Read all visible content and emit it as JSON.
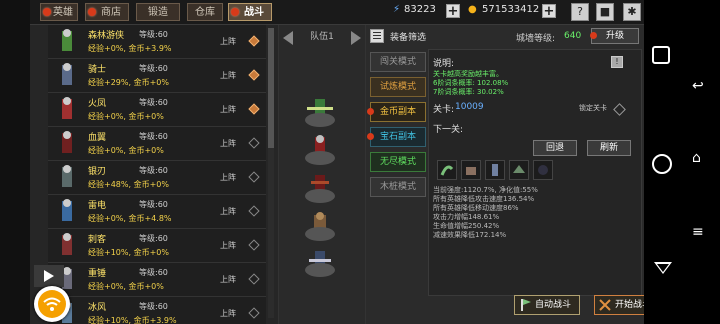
{
  "tabs": [
    {
      "label": "英雄",
      "dot": true,
      "active": false
    },
    {
      "label": "商店",
      "dot": true,
      "active": false
    },
    {
      "label": "锻造",
      "dot": false,
      "active": false
    },
    {
      "label": "仓库",
      "dot": false,
      "active": false
    },
    {
      "label": "战斗",
      "dot": true,
      "active": true
    }
  ],
  "resources": {
    "energy": "83223",
    "gold": "571533412"
  },
  "heroes": [
    {
      "name": "森林游侠",
      "level": "等级:60",
      "bonus": "经验+0%, 金币+3.9%",
      "deploy": "上阵",
      "active": true
    },
    {
      "name": "骑士",
      "level": "等级:60",
      "bonus": "经验+29%, 金币+0%",
      "deploy": "上阵",
      "active": true
    },
    {
      "name": "火凤",
      "level": "等级:60",
      "bonus": "经验+0%, 金币+0%",
      "deploy": "上阵",
      "active": true
    },
    {
      "name": "血翼",
      "level": "等级:60",
      "bonus": "经验+0%, 金币+0%",
      "deploy": "上阵",
      "active": false
    },
    {
      "name": "银刃",
      "level": "等级:60",
      "bonus": "经验+48%, 金币+0%",
      "deploy": "上阵",
      "active": false
    },
    {
      "name": "雷电",
      "level": "等级:60",
      "bonus": "经验+0%, 金币+4.8%",
      "deploy": "上阵",
      "active": false
    },
    {
      "name": "刺客",
      "level": "等级:60",
      "bonus": "经验+10%, 金币+0%",
      "deploy": "上阵",
      "active": false
    },
    {
      "name": "重锤",
      "level": "等级:60",
      "bonus": "经验+0%, 金币+0%",
      "deploy": "上阵",
      "active": false
    },
    {
      "name": "冰风",
      "level": "等级:60",
      "bonus": "经验+10%, 金币+3.9%",
      "deploy": "上阵",
      "active": false
    }
  ],
  "team": {
    "label": "队伍1"
  },
  "panel": {
    "title": "装备筛选",
    "city_label": "城墙等级:",
    "city_level": "640",
    "upgrade": "升级",
    "modes": [
      "闯关模式",
      "试炼模式",
      "金币副本",
      "宝石副本",
      "无尽模式",
      "木桩模式"
    ],
    "desc_label": "说明:",
    "desc_lines": [
      "关卡越高奖励越丰富。",
      "6阶词条概率: 102.08%",
      "7阶词条概率: 30.02%"
    ],
    "stage_label": "关卡:",
    "stage_value": "10009",
    "lock_label": "锁定关卡",
    "next_label": "下一关:",
    "back_btn": "回退",
    "refresh_btn": "刷新",
    "stats": [
      "当前强度:1120.7%, 净化值:55%",
      "所有英雄降低攻击速度136.54%",
      "所有英雄降低移动速度86%",
      "攻击力增幅148.61%",
      "生命值增幅250.42%",
      "减速效果降低172.14%"
    ],
    "auto_btn": "自动战斗",
    "start_btn": "开始战斗"
  },
  "colors": {
    "accent": "#b79a6a",
    "notify": "#d83a1a",
    "hero_name": "#ffe46a",
    "bonus": "#f3d24a"
  }
}
